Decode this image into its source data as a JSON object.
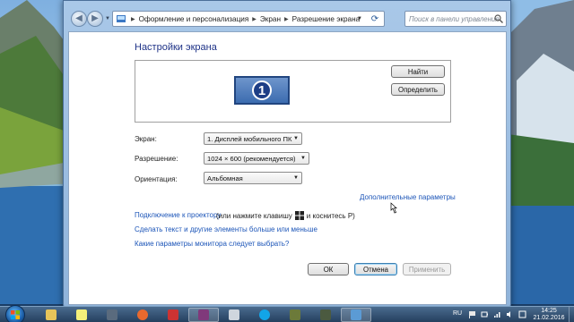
{
  "window": {
    "breadcrumb": [
      "Оформление и персонализация",
      "Экран",
      "Разрешение экрана"
    ],
    "search_placeholder": "Поиск в панели управления"
  },
  "display_settings": {
    "title": "Настройки экрана",
    "monitor_number": "1",
    "find_button": "Найти",
    "identify_button": "Определить",
    "screen_label": "Экран:",
    "screen_value": "1. Дисплей мобильного ПК",
    "resolution_label": "Разрешение:",
    "resolution_value": "1024 × 600 (рекомендуется)",
    "orientation_label": "Ориентация:",
    "orientation_value": "Альбомная",
    "advanced_link": "Дополнительные параметры",
    "projector_link": "Подключение к проектору",
    "projector_note_before": "(или нажмите клавишу",
    "projector_note_after": "и коснитесь P)",
    "text_size_link": "Сделать текст и другие элементы больше или меньше",
    "which_monitor_link": "Какие параметры монитора следует выбрать?",
    "ok_button": "ОК",
    "cancel_button": "Отмена",
    "apply_button": "Применить"
  },
  "taskbar": {
    "items": [
      "explorer",
      "sticky-notes",
      "floppy",
      "firefox",
      "generic-app",
      "onenote",
      "screen-app",
      "skype",
      "game-app",
      "image-app",
      "control-panel"
    ],
    "language": "RU",
    "time": "14:25",
    "date": "21.02.2016"
  },
  "colors": {
    "link": "#1c55b8",
    "title": "#1e3287",
    "monitor_fill": "#3c6cb0"
  }
}
